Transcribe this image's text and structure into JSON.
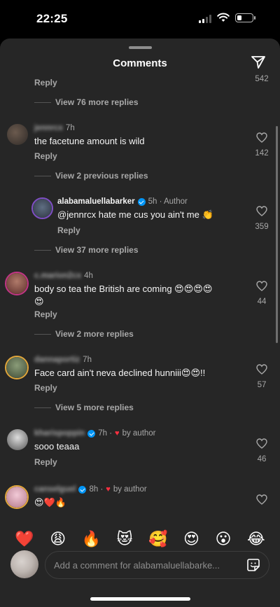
{
  "status_bar": {
    "time": "22:25"
  },
  "sheet": {
    "title": "Comments"
  },
  "top_partial": {
    "reply": "Reply",
    "likes": "542"
  },
  "view_76": "View 76 more replies",
  "c1": {
    "username": "jennrcx",
    "time": "7h",
    "text": "the facetune amount is wild",
    "reply": "Reply",
    "likes": "142"
  },
  "view_prev": "View 2 previous replies",
  "c2": {
    "username": "alabamaluellabarker",
    "meta": "5h · Author",
    "text": "@jennrcx hate me cus you ain't me 👏",
    "reply": "Reply",
    "likes": "359"
  },
  "view_37": "View 37 more replies",
  "c3": {
    "username": "c.marion2cx",
    "time": "4h",
    "text": "body so tea the British are coming 😍😍😍😍",
    "text2": "😍",
    "reply": "Reply",
    "likes": "44"
  },
  "view_2": "View 2 more replies",
  "c4": {
    "username": "dannaportiz",
    "time": "7h",
    "text": "Face card ain't neva declined hunniii😍😍!!",
    "reply": "Reply",
    "likes": "57"
  },
  "view_5": "View 5 more replies",
  "c5": {
    "username": "kharispoppin",
    "time": "7h ·",
    "by": "by author",
    "text": "sooo teaaa",
    "reply": "Reply",
    "likes": "46"
  },
  "c6": {
    "username": "canselguel",
    "time": "8h ·",
    "by": "by author",
    "text": "😍❤️🔥"
  },
  "emoji_bar": [
    "❤️",
    "😩",
    "🔥",
    "😻",
    "🥰",
    "😍",
    "😮",
    "😂"
  ],
  "composer": {
    "placeholder": "Add a comment for alabamaluellabarke..."
  }
}
